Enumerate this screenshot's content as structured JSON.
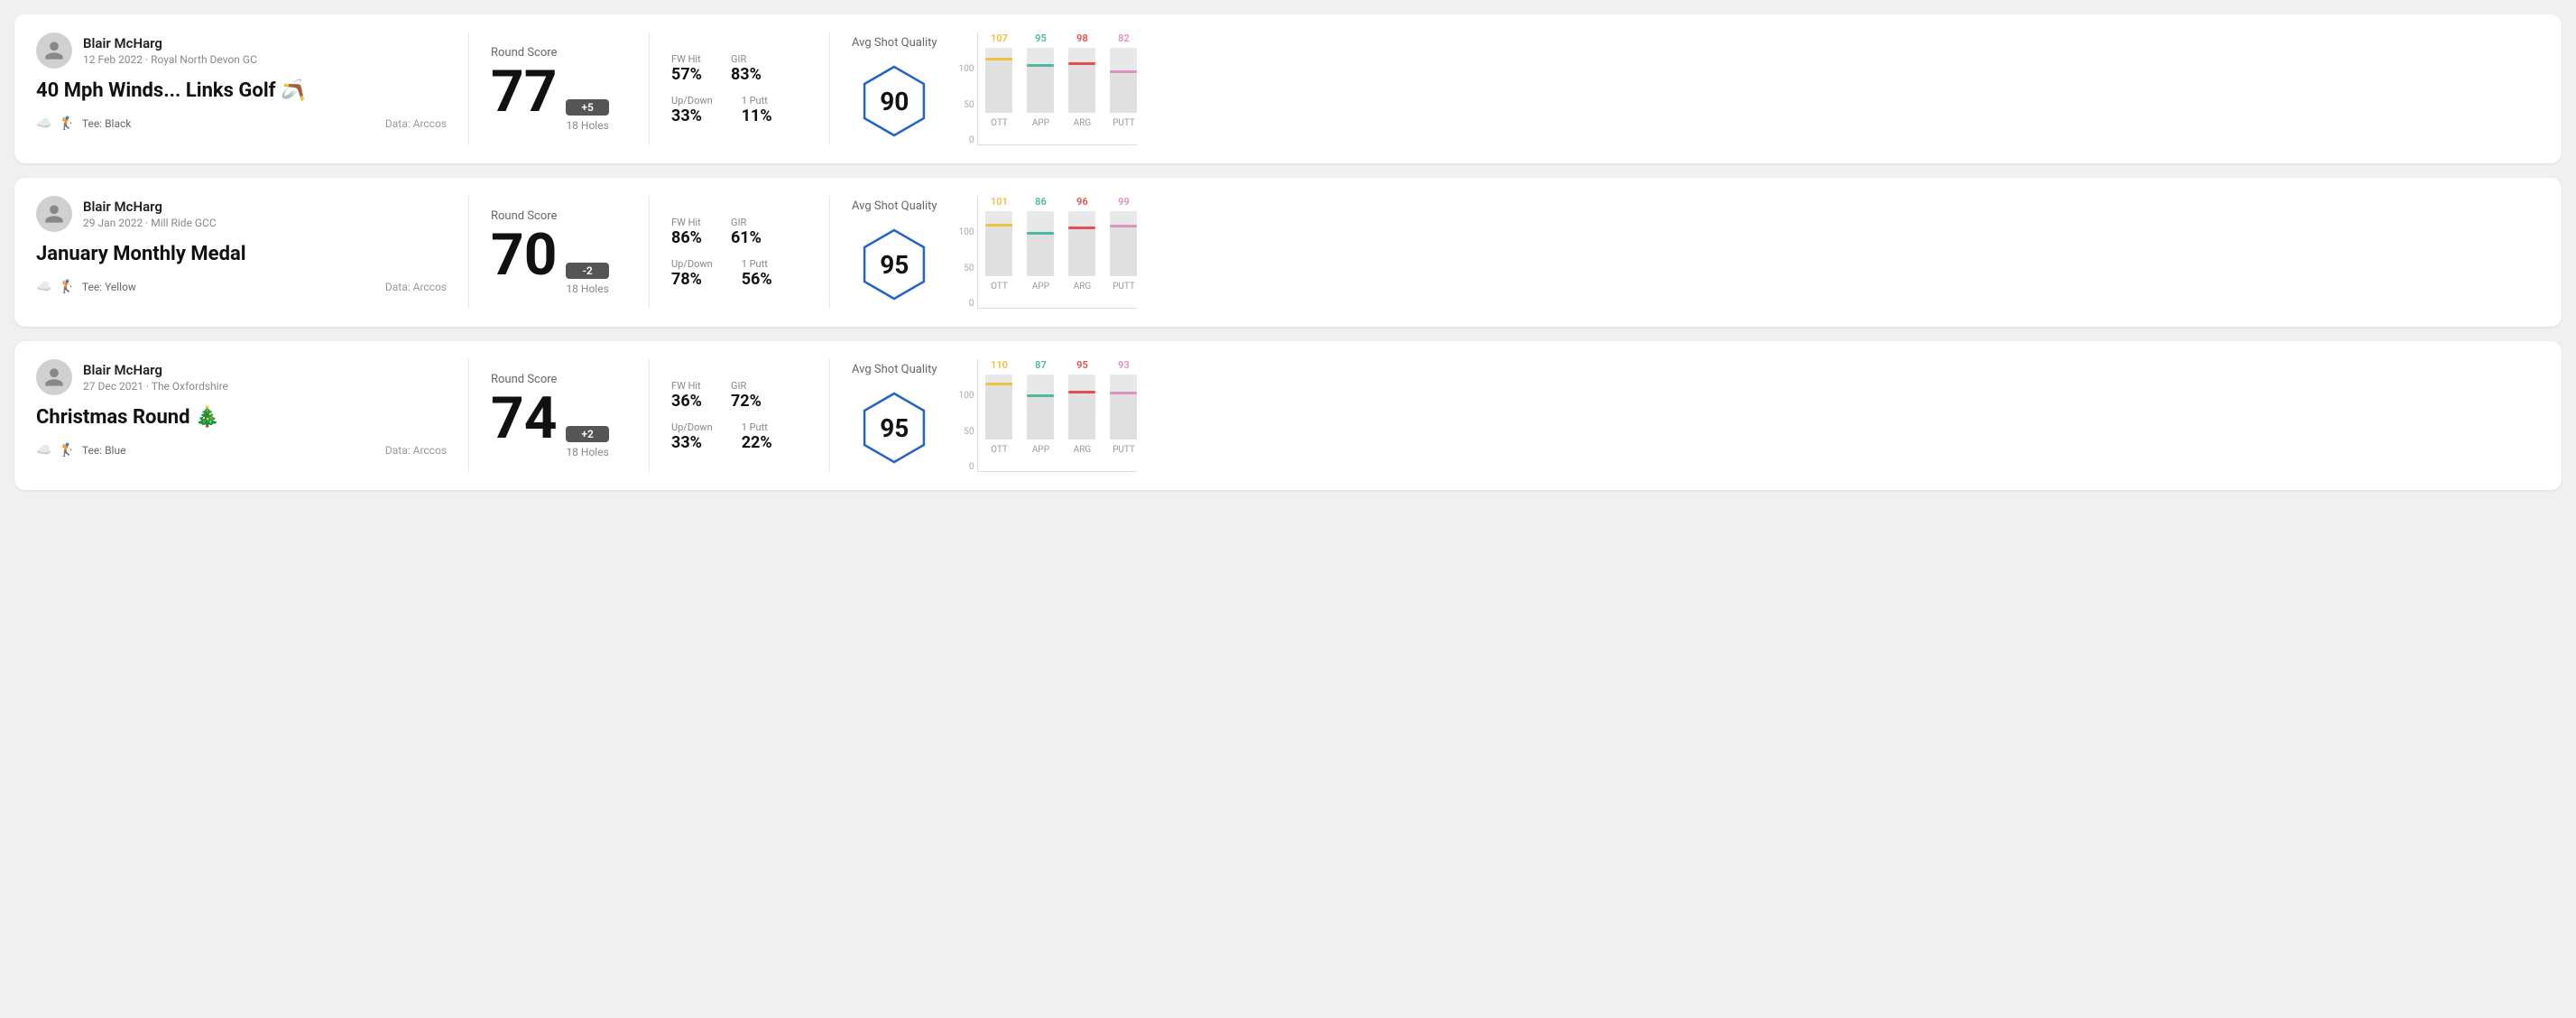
{
  "rounds": [
    {
      "id": "round1",
      "player_name": "Blair McHarg",
      "player_meta": "12 Feb 2022 · Royal North Devon GC",
      "title": "40 Mph Winds... Links Golf 🪃",
      "tee": "Black",
      "data_source": "Data: Arccos",
      "score": "77",
      "score_diff": "+5",
      "score_diff_sign": "positive",
      "holes": "18 Holes",
      "fw_hit": "57%",
      "gir": "83%",
      "up_down": "33%",
      "one_putt": "11%",
      "avg_shot_quality": "90",
      "chart": {
        "ott": {
          "value": 107,
          "color": "#f0c040",
          "height_pct": 85
        },
        "app": {
          "value": 95,
          "color": "#4db8a0",
          "height_pct": 75
        },
        "arg": {
          "value": 98,
          "color": "#e05050",
          "height_pct": 78
        },
        "putt": {
          "value": 82,
          "color": "#e090c0",
          "height_pct": 65
        }
      }
    },
    {
      "id": "round2",
      "player_name": "Blair McHarg",
      "player_meta": "29 Jan 2022 · Mill Ride GCC",
      "title": "January Monthly Medal",
      "tee": "Yellow",
      "data_source": "Data: Arccos",
      "score": "70",
      "score_diff": "-2",
      "score_diff_sign": "negative",
      "holes": "18 Holes",
      "fw_hit": "86%",
      "gir": "61%",
      "up_down": "78%",
      "one_putt": "56%",
      "avg_shot_quality": "95",
      "chart": {
        "ott": {
          "value": 101,
          "color": "#f0c040",
          "height_pct": 80
        },
        "app": {
          "value": 86,
          "color": "#4db8a0",
          "height_pct": 68
        },
        "arg": {
          "value": 96,
          "color": "#e05050",
          "height_pct": 76
        },
        "putt": {
          "value": 99,
          "color": "#e090c0",
          "height_pct": 79
        }
      }
    },
    {
      "id": "round3",
      "player_name": "Blair McHarg",
      "player_meta": "27 Dec 2021 · The Oxfordshire",
      "title": "Christmas Round 🎄",
      "tee": "Blue",
      "data_source": "Data: Arccos",
      "score": "74",
      "score_diff": "+2",
      "score_diff_sign": "positive",
      "holes": "18 Holes",
      "fw_hit": "36%",
      "gir": "72%",
      "up_down": "33%",
      "one_putt": "22%",
      "avg_shot_quality": "95",
      "chart": {
        "ott": {
          "value": 110,
          "color": "#f0c040",
          "height_pct": 88
        },
        "app": {
          "value": 87,
          "color": "#4db8a0",
          "height_pct": 69
        },
        "arg": {
          "value": 95,
          "color": "#e05050",
          "height_pct": 75
        },
        "putt": {
          "value": 93,
          "color": "#e090c0",
          "height_pct": 74
        }
      }
    }
  ],
  "chart_labels": {
    "ott": "OTT",
    "app": "APP",
    "arg": "ARG",
    "putt": "PUTT"
  },
  "y_axis": {
    "top": "100",
    "mid": "50",
    "bot": "0"
  }
}
